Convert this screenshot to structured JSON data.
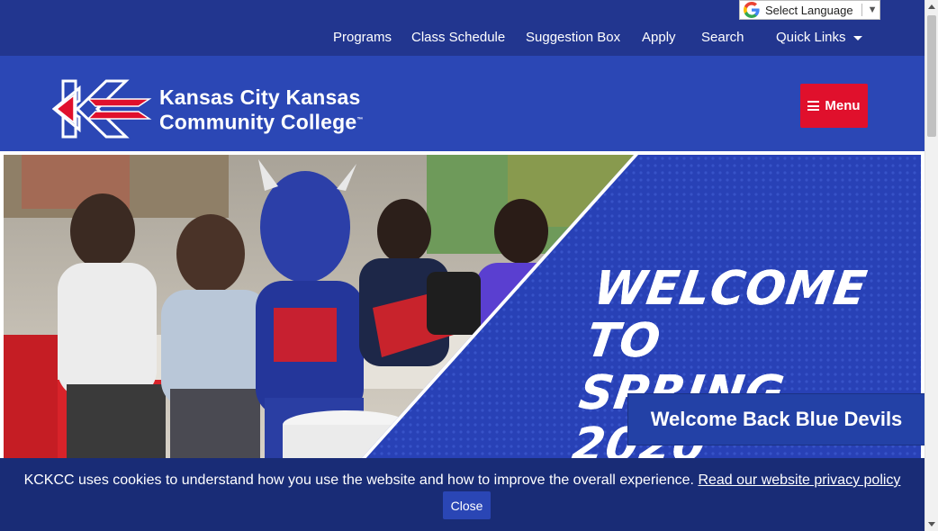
{
  "language": {
    "label": "Select Language",
    "arrow": "▼"
  },
  "nav": {
    "programs": "Programs",
    "class_schedule": "Class Schedule",
    "suggestion_box": "Suggestion Box",
    "apply": "Apply",
    "search": "Search",
    "quick_links": "Quick Links"
  },
  "brand": {
    "line1": "Kansas City Kansas",
    "line2": "Community College",
    "tm": "™"
  },
  "menu_button": "Menu",
  "hero": {
    "headline_line1": "WELCOME TO",
    "headline_line2": "SPRING 2020",
    "caption": "Welcome Back Blue Devils",
    "prev_icon": "chevron-left-icon",
    "next_icon": "chevron-right-icon"
  },
  "cookie": {
    "text": "KCKCC uses cookies to understand how you use the website and how to improve the overall experience.",
    "link": "Read our website privacy policy",
    "close": "Close"
  },
  "colors": {
    "top_bar": "#22368f",
    "header": "#2b47b5",
    "accent_red": "#e0102c",
    "cookie_bar": "#192c76"
  }
}
